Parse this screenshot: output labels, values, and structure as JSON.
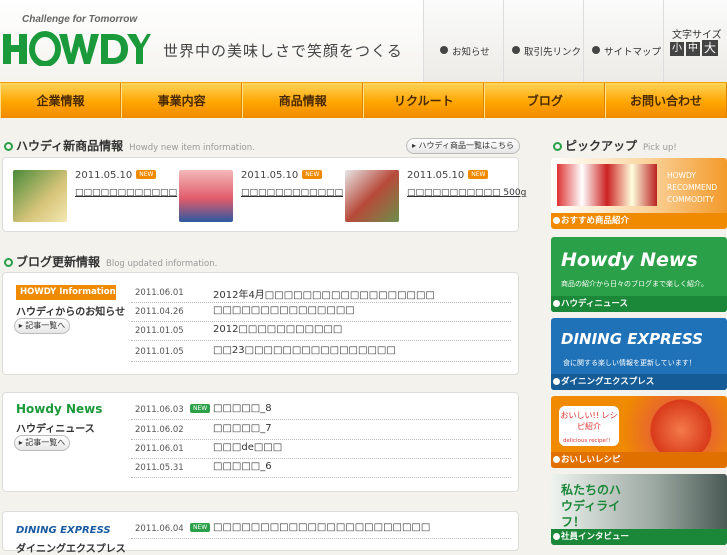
{
  "header": {
    "tagline": "Challenge for Tomorrow",
    "slogan": "世界中の美味しさで笑顔をつくる",
    "links": [
      "お知らせ",
      "取引先リンク",
      "サイトマップ"
    ],
    "font_size": {
      "label": "文字サイズ",
      "small": "小",
      "medium": "中",
      "large": "大"
    }
  },
  "nav": [
    "企業情報",
    "事業内容",
    "商品情報",
    "リクルート",
    "ブログ",
    "お問い合わせ"
  ],
  "new_items": {
    "title": "ハウディ新商品情報",
    "subtitle": "Howdy new item information.",
    "more": "ハウディ商品一覧はこちら",
    "items": [
      {
        "date": "2011.05.10",
        "badge": "NEW",
        "name": "□□□□□□□□□□□□"
      },
      {
        "date": "2011.05.10",
        "badge": "NEW",
        "name": "□□□□□□□□□□□□"
      },
      {
        "date": "2011.05.10",
        "badge": "NEW",
        "name": "□□□□□□□□□□□ 500g"
      }
    ]
  },
  "blog": {
    "title": "ブログ更新情報",
    "subtitle": "Blog updated information.",
    "more_label": "記事一覧へ",
    "groups": [
      {
        "tag": "HOWDY Information",
        "name": "ハウディからのお知らせ",
        "rows": [
          {
            "date": "2011.06.01",
            "new": "",
            "text": "2012年4月□□□□□□□□□□□□□□□□□□"
          },
          {
            "date": "2011.04.26",
            "new": "",
            "text": "□□□□□□□□□□□□□□□"
          },
          {
            "date": "2011.01.05",
            "new": "",
            "text": "2012□□□□□□□□□□□"
          },
          {
            "date": "2011.01.05",
            "new": "",
            "text": "□□23□□□□□□□□□□□□□□□□"
          }
        ]
      },
      {
        "tag": "Howdy News",
        "name": "ハウディニュース",
        "rows": [
          {
            "date": "2011.06.03",
            "new": "NEW",
            "text": "□□□□□_8"
          },
          {
            "date": "2011.06.02",
            "new": "",
            "text": "□□□□□_7"
          },
          {
            "date": "2011.06.01",
            "new": "",
            "text": "□□□de□□□"
          },
          {
            "date": "2011.05.31",
            "new": "",
            "text": "□□□□□_6"
          }
        ]
      },
      {
        "tag": "DINING EXPRESS",
        "name": "ダイニングエクスプレス",
        "rows": [
          {
            "date": "2011.06.04",
            "new": "NEW",
            "text": "□□□□□□□□□□□□□□□□□□□□□□□"
          }
        ]
      }
    ]
  },
  "pickup": {
    "title": "ピックアップ",
    "subtitle": "Pick up!",
    "items": [
      {
        "caption": "おすすめ商品紹介",
        "text": "HOWDY RECOMMEND COMMODITY"
      },
      {
        "caption": "ハウディニュース",
        "text": "Howdy News",
        "sub": "商品の紹介から日々のブログまで楽しく紹介。"
      },
      {
        "caption": "ダイニングエクスプレス",
        "text": "DINING EXPRESS",
        "sub": "食に関する楽しい情報を更新しています！"
      },
      {
        "caption": "おいしいレシピ",
        "text": "おいしい!! レシピ紹介",
        "sub": "delicious recipe!!"
      },
      {
        "caption": "社員インタビュー",
        "text": "私たちのハウディライフ！"
      }
    ]
  }
}
